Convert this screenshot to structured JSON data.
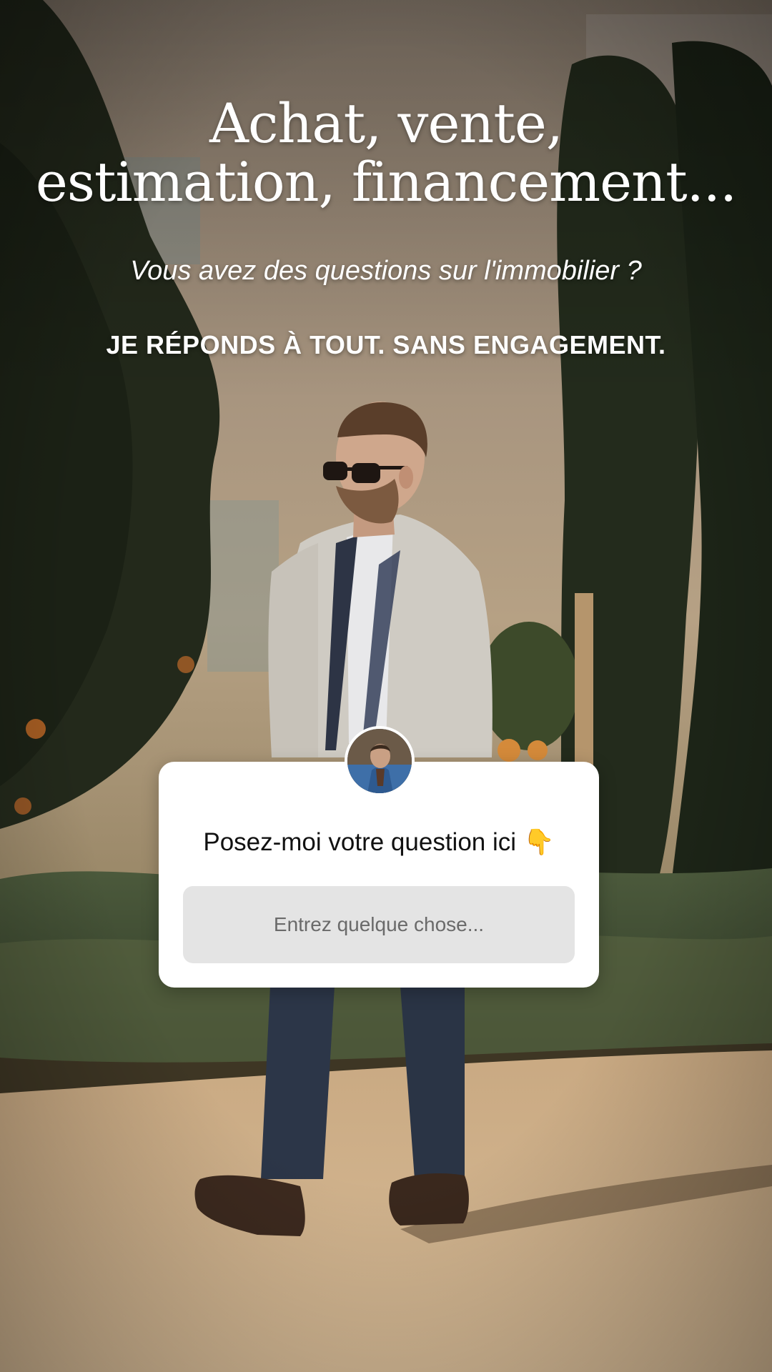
{
  "story": {
    "headline_line1": "Achat, vente,",
    "headline_line2": "estimation, financement...",
    "subtitle": "Vous avez des questions sur l'immobilier ?",
    "tagline": "JE RÉPONDS À TOUT. SANS ENGAGEMENT."
  },
  "question_sticker": {
    "prompt": "Posez-moi votre question ici",
    "emoji": "👇",
    "input_value": "",
    "input_placeholder": "Entrez quelque chose..."
  },
  "colors": {
    "text": "#ffffff",
    "card": "#ffffff",
    "input_bg": "#e4e4e4"
  }
}
